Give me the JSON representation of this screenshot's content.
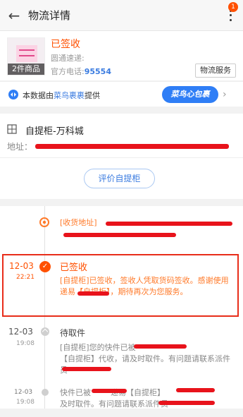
{
  "header": {
    "title": "物流详情",
    "back_icon": "←",
    "notification_count": "1"
  },
  "package": {
    "item_count": "2件商品",
    "status": "已签收",
    "courier_label": "圆通速递:",
    "phone_label": "官方电话:",
    "phone": "95554",
    "service_button": "物流服务"
  },
  "source": {
    "prefix": "本数据由",
    "provider": "菜鸟裹裹",
    "suffix": "提供",
    "banner": "菜鸟心包裹"
  },
  "locker": {
    "name": "自提柜-万科城",
    "address_label": "地址：",
    "rate_button": "评价自提柜"
  },
  "timeline": {
    "receiving_address_label": "[收货地址]",
    "events": [
      {
        "date": "12-03",
        "time": "22:21",
        "status": "已签收",
        "message": "[自提柜]已签收，签收人凭取货码签收。感谢使用",
        "message_line2": "递易【自提柜】，期待再次为您服务。"
      },
      {
        "date": "12-03",
        "time": "19:08",
        "status": "待取件",
        "message_a": "[自提柜]您的快件已被",
        "message_b": "【自提柜】代收，请及时取件。有问题请联系派件员"
      },
      {
        "date": "12-03",
        "time": "19:08",
        "message_a": "快件已被",
        "message_b": "递易【自提柜】",
        "message_c": "及时取件。有问题请联系派件员"
      }
    ]
  },
  "colors": {
    "accent": "#ff5000",
    "link": "#3a7be0",
    "highlight_border": "#e82d1a"
  }
}
